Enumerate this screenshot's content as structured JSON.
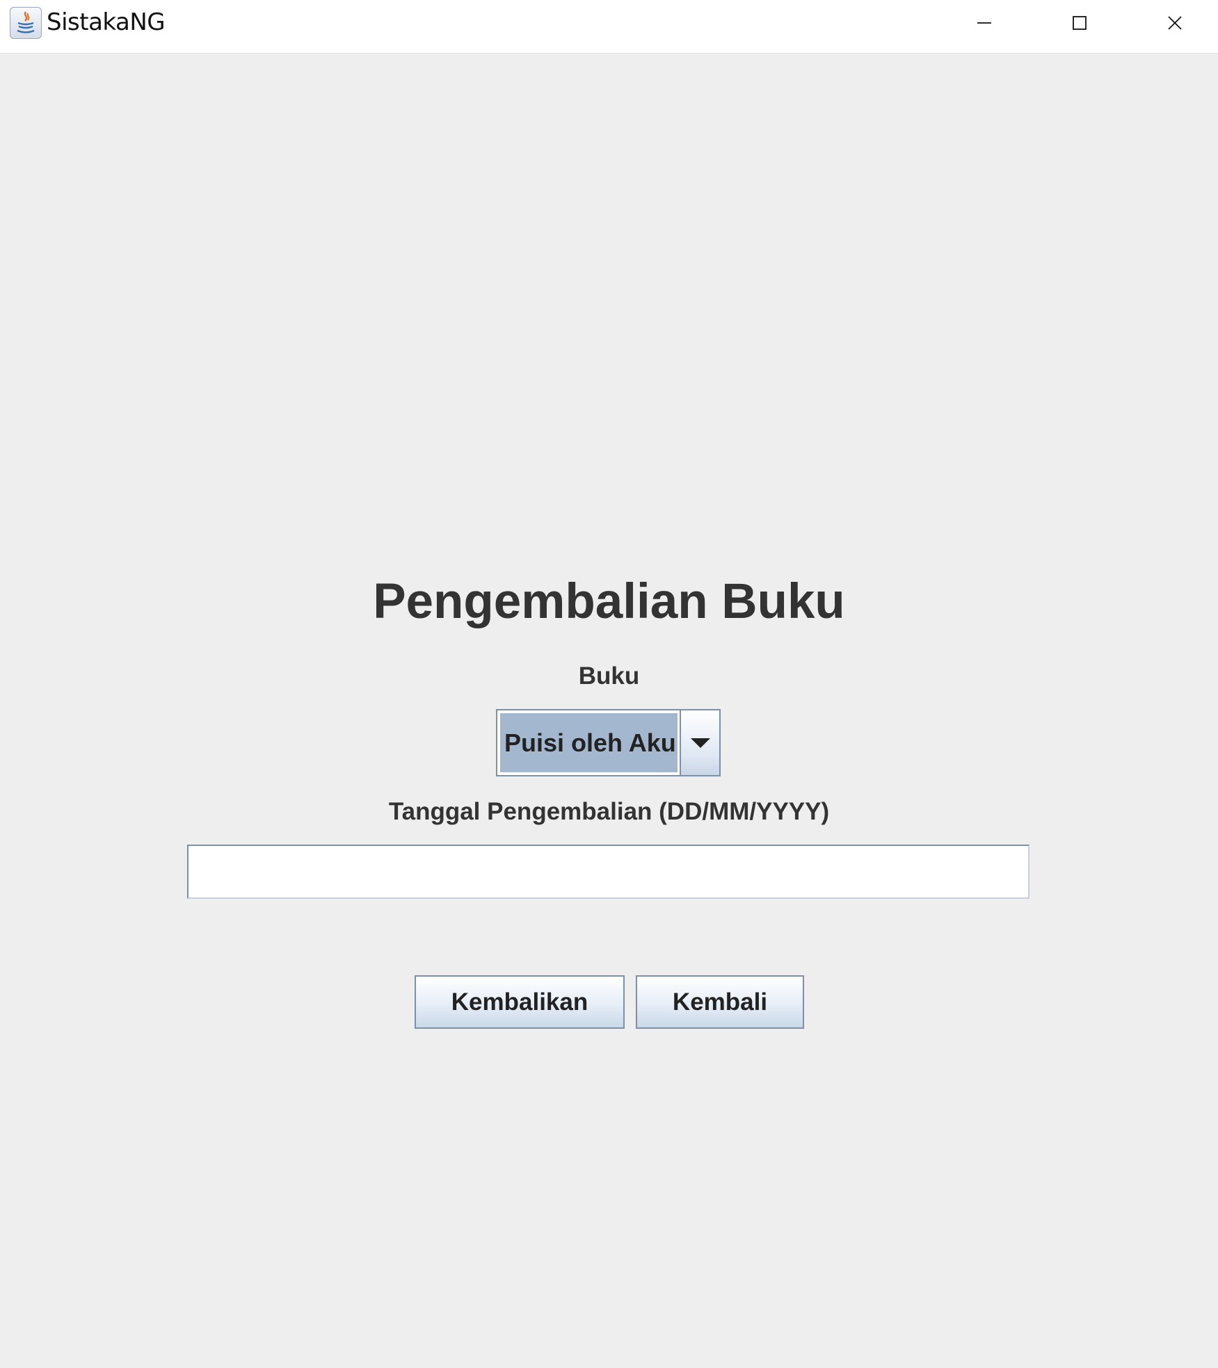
{
  "window": {
    "title": "SistakaNG",
    "controls": {
      "minimize": "minimize-icon",
      "maximize": "maximize-icon",
      "close": "close-icon"
    }
  },
  "form": {
    "title": "Pengembalian Buku",
    "book_label": "Buku",
    "book_selected": "Puisi oleh Aku",
    "date_label": "Tanggal Pengembalian (DD/MM/YYYY)",
    "date_value": "",
    "return_button": "Kembalikan",
    "back_button": "Kembali"
  },
  "colors": {
    "background": "#eeeeee",
    "combo_selection": "#a3b8cf",
    "border": "#7d8fa9",
    "text": "#333333"
  }
}
